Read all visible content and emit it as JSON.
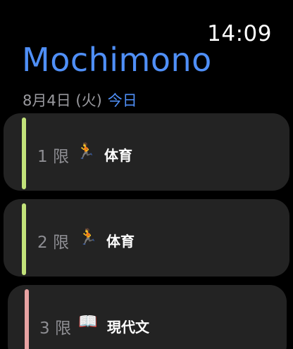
{
  "status": {
    "time": "14:09"
  },
  "header": {
    "title": "Mochimono",
    "date": "8月4日 (火)",
    "today": "今日"
  },
  "periods": [
    {
      "label": "1 限",
      "emoji": "🏃",
      "subject": "体育",
      "color": "#c2e27a"
    },
    {
      "label": "2 限",
      "emoji": "🏃",
      "subject": "体育",
      "color": "#c2e27a"
    },
    {
      "label": "3 限",
      "emoji": "📖",
      "subject": "現代文",
      "color": "#e8a3a3"
    }
  ]
}
